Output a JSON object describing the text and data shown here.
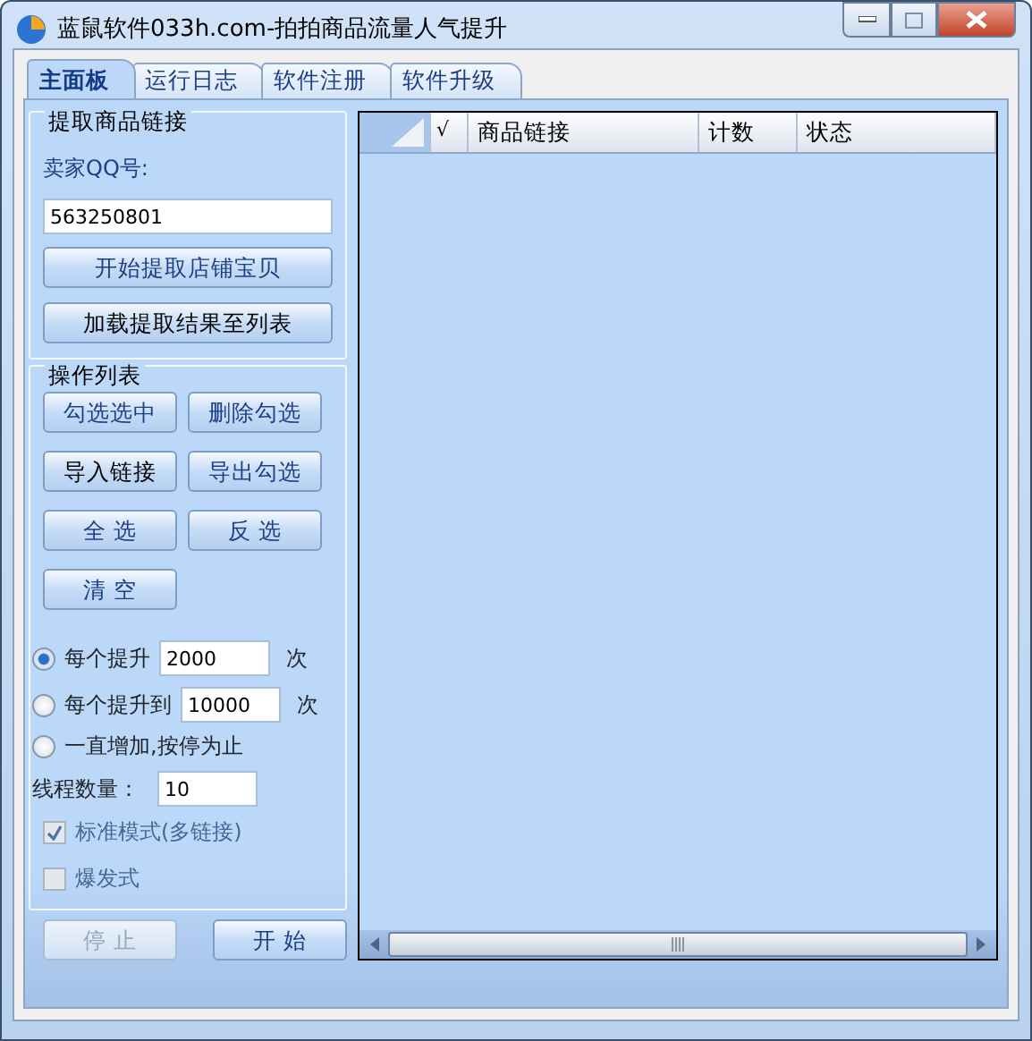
{
  "window": {
    "title": "蓝鼠软件033h.com-拍拍商品流量人气提升"
  },
  "tabs": [
    {
      "label": "主面板",
      "selected": true
    },
    {
      "label": "运行日志",
      "selected": false
    },
    {
      "label": "软件注册",
      "selected": false
    },
    {
      "label": "软件升级",
      "selected": false
    }
  ],
  "extract_group": {
    "title": "提取商品链接",
    "seller_label": "卖家QQ号:",
    "seller_field": {
      "value": "563250801"
    },
    "buttons": [
      "开始提取店铺宝贝",
      "加载提取结果至列表"
    ]
  },
  "ops_group": {
    "title": "操作列表",
    "buttons": [
      "勾选选中",
      "删除勾选",
      "导入链接",
      "导出勾选",
      "全 选",
      "反 选",
      "清 空"
    ],
    "modes": [
      {
        "label": "每个提升",
        "value": "2000",
        "unit": "次",
        "selected": true
      },
      {
        "label": "每个提升到",
        "value": "10000",
        "unit": "次",
        "selected": false
      },
      {
        "label": "一直增加,按停为止",
        "selected": false
      }
    ],
    "thread": {
      "label": "线程数量：",
      "value": "10"
    },
    "options": [
      {
        "label": "标准模式(多链接)",
        "checked": true,
        "disabled": true
      },
      {
        "label": "爆发式",
        "checked": false,
        "disabled": true
      }
    ]
  },
  "actions": [
    {
      "label": "停 止",
      "disabled": true
    },
    {
      "label": "开 始",
      "disabled": false
    }
  ],
  "table": {
    "columns": [
      "√",
      "商品链接",
      "计数",
      "状态"
    ]
  }
}
